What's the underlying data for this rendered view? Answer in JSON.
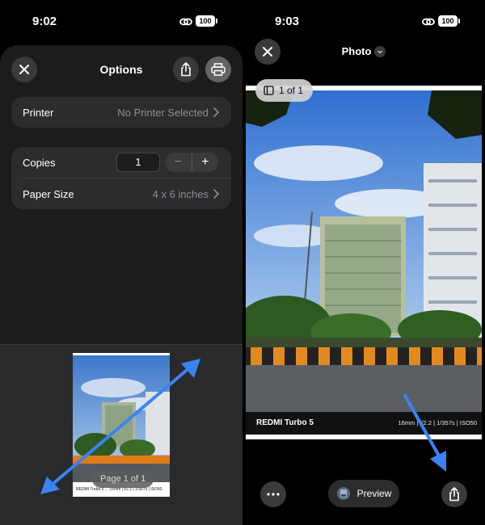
{
  "left": {
    "status": {
      "time": "9:02",
      "battery": "100"
    },
    "title": "Options",
    "printer": {
      "label": "Printer",
      "value": "No Printer Selected"
    },
    "copies": {
      "label": "Copies",
      "value": "1",
      "minus": "−",
      "plus": "+"
    },
    "paper_size": {
      "label": "Paper Size",
      "value": "4 x 6 inches"
    },
    "preview": {
      "page_indicator": "Page 1 of 1",
      "caption": "REDMI Turbo 5 ... 16mm | f/2.2 | 1/357s | ISO50"
    }
  },
  "right": {
    "status": {
      "time": "9:03",
      "battery": "100"
    },
    "title": "Photo",
    "count": "1 of 1",
    "caption": {
      "model": "REDMI Turbo 5",
      "specs": "16mm | f/2.2 | 1/357s | ISO50"
    },
    "preview_label": "Preview"
  },
  "colors": {
    "accent_arrow": "#3b82f6",
    "sheet_bg": "#1c1c1e",
    "row_bg": "#2c2c2e"
  },
  "icons": [
    "close-icon",
    "share-icon",
    "printer-icon",
    "chevron-right-icon",
    "link-icon",
    "more-icon",
    "image-stack-icon"
  ]
}
